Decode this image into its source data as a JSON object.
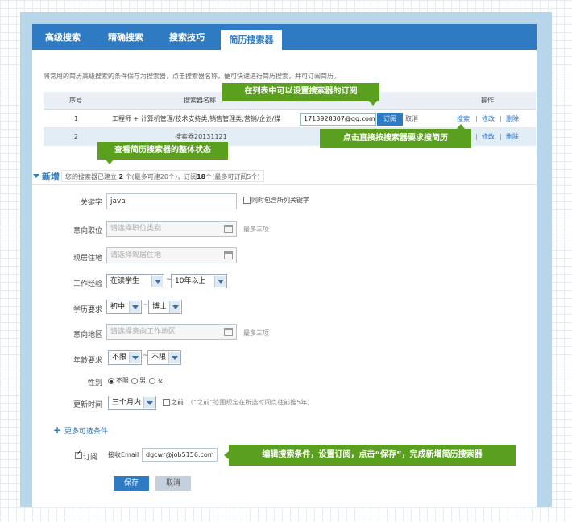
{
  "tabs": [
    "高级搜索",
    "精确搜索",
    "搜索技巧",
    "简历搜索器"
  ],
  "description": "将常用的简历高级搜索的条件保存为搜索器，点击搜索器名称，便可快速进行简历搜索，并可订阅简历。",
  "table": {
    "headers": [
      "序号",
      "搜索器名称",
      "操作"
    ],
    "rows": [
      {
        "index": "1",
        "name": "工程师 + 计算机管理/技术支持类;销售管理类;营销/企划/媒",
        "email": "1713928307@qq.com",
        "subscribe": "订阅",
        "cancel": "取消",
        "ops": [
          "搜索",
          "修改",
          "删除"
        ]
      },
      {
        "index": "2",
        "name": "搜索器20131121",
        "ops": [
          "搜索",
          "修改",
          "删除"
        ]
      }
    ],
    "sep": "|"
  },
  "callouts": {
    "set_subscribe": "在列表中可以设置搜索器的订阅",
    "direct_search": "点击直接按搜索器要求搜简历",
    "overall_status": "查看简历搜索器的整体状态",
    "edit_hint": "编辑搜索条件，设置订阅，点击“保存”，完成新增简历搜索器"
  },
  "add_section": {
    "title": "新增",
    "count_prefix": "您的搜索器已建立",
    "count_created": "2",
    "count_mid": "个(最多可建20个)，订阅",
    "count_subscribed": "18",
    "count_suffix": "个(最多可订阅5个)"
  },
  "form": {
    "keyword_label": "关键字",
    "keyword_value": "java",
    "keyword_option": "同时包含所列关键字",
    "position_label": "意向职位",
    "position_placeholder": "请选择职位类别",
    "max_three": "最多三项",
    "residence_label": "现居住地",
    "residence_placeholder": "请选择现居住地",
    "experience_label": "工作经验",
    "experience_from": "在读学生",
    "experience_to": "10年以上",
    "education_label": "学历要求",
    "education_from": "初中",
    "education_to": "博士",
    "region_label": "意向地区",
    "region_placeholder": "请选择意向工作地区",
    "age_label": "年龄要求",
    "age_from": "不限",
    "age_to": "不限",
    "gender_label": "性别",
    "gender_options": [
      "不限",
      "男",
      "女"
    ],
    "update_label": "更新时间",
    "update_value": "三个月内",
    "before_label": "之前",
    "before_note": "（“之前”范围规定在所选时间点往前推5年）",
    "tilde": "~"
  },
  "more_conditions": "更多可选条件",
  "subscription": {
    "label": "订阅",
    "email_label": "接收Email",
    "email_value": "dgcwr@job5156.com"
  },
  "buttons": {
    "save": "保存",
    "cancel": "取消"
  }
}
